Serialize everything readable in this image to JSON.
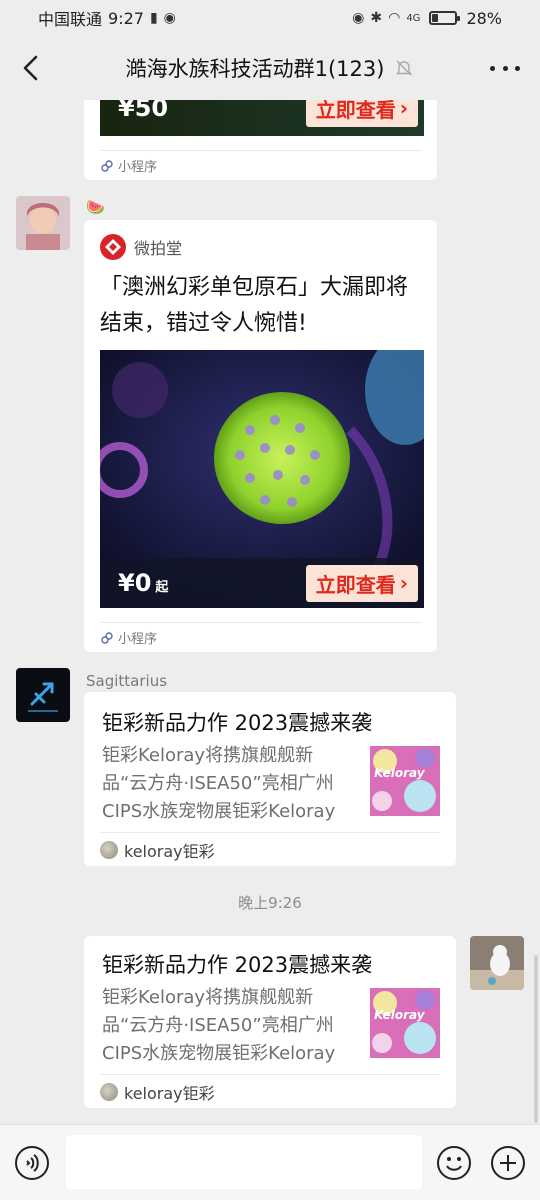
{
  "status": {
    "carrier": "中国联通",
    "time": "9:27",
    "battery": "28%",
    "battery_fraction": 0.28,
    "signal_label": "4G"
  },
  "header": {
    "title": "澔海水族科技活动群1(123)",
    "icons": [
      "back-arrow-icon",
      "mute-bell-icon",
      "more-icon"
    ]
  },
  "messages": {
    "top_card": {
      "price": "¥50",
      "button": "立即查看",
      "source": "小程序"
    },
    "card1": {
      "sender": "🍉",
      "app_name": "微拍堂",
      "title": "「澳洲幻彩单包原石」大漏即将结束，错过令人惋惜!",
      "price": "¥0",
      "price_suffix": "起",
      "button": "立即查看",
      "source": "小程序"
    },
    "card2": {
      "sender": "Sagittarius",
      "title": "钜彩新品力作 2023震撼来袭",
      "desc": "钜彩Keloray将携旗舰舰新品“云方舟·ISEA50”亮相广州CIPS水族宠物展钜彩Keloray以…",
      "thumb_text": "Keloray",
      "source": "keloray钜彩"
    },
    "timestamp": "晚上9:26",
    "card3": {
      "title": "钜彩新品力作 2023震撼来袭",
      "desc": "钜彩Keloray将携旗舰舰新品“云方舟·ISEA50”亮相广州CIPS水族宠物展钜彩Keloray以…",
      "thumb_text": "Keloray",
      "source": "keloray钜彩"
    }
  },
  "input": {
    "icons": [
      "voice-icon",
      "emoji-icon",
      "plus-icon"
    ]
  },
  "colors": {
    "background": "#ededed",
    "bubble": "#ffffff",
    "button_text": "#e0291c",
    "button_bg": "#fbe3d8"
  }
}
